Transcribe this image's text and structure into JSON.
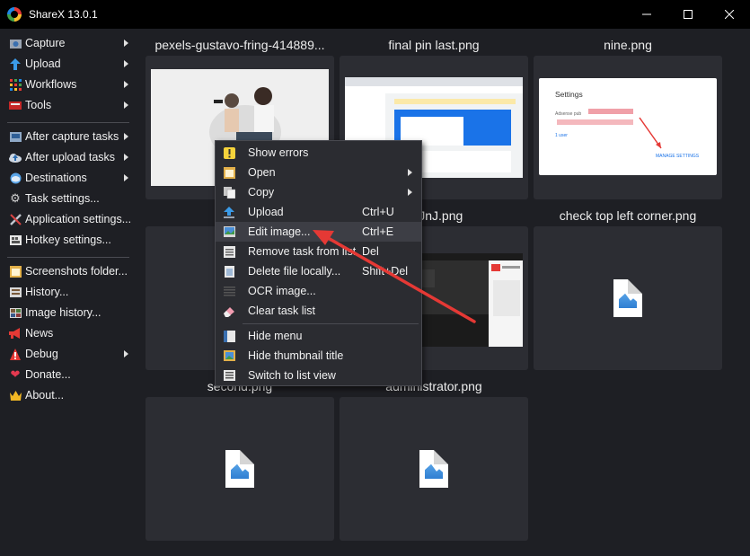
{
  "window": {
    "title": "ShareX 13.0.1",
    "minimize": "—",
    "maximize": "☐",
    "close": "✕"
  },
  "sidebar": {
    "items": [
      {
        "label": "Capture",
        "icon": "capture-icon"
      },
      {
        "label": "Upload",
        "icon": "upload-icon"
      },
      {
        "label": "Workflows",
        "icon": "workflows-icon"
      },
      {
        "label": "Tools",
        "icon": "tools-icon"
      },
      {
        "label": "After capture tasks",
        "icon": "after-capture-icon"
      },
      {
        "label": "After upload tasks",
        "icon": "after-upload-icon"
      },
      {
        "label": "Destinations",
        "icon": "destinations-icon"
      },
      {
        "label": "Task settings...",
        "icon": "gear-icon"
      },
      {
        "label": "Application settings...",
        "icon": "wrench-icon"
      },
      {
        "label": "Hotkey settings...",
        "icon": "keyboard-icon"
      },
      {
        "label": "Screenshots folder...",
        "icon": "folder-icon"
      },
      {
        "label": "History...",
        "icon": "history-icon"
      },
      {
        "label": "Image history...",
        "icon": "image-history-icon"
      },
      {
        "label": "News",
        "icon": "megaphone-icon"
      },
      {
        "label": "Debug",
        "icon": "debug-icon"
      },
      {
        "label": "Donate...",
        "icon": "heart-icon"
      },
      {
        "label": "About...",
        "icon": "crown-icon"
      }
    ]
  },
  "tiles": [
    {
      "title": "pexels-gustavo-fring-414889..."
    },
    {
      "title": "final pin last.png"
    },
    {
      "title": "nine.png"
    },
    {
      "title": "LnJnJ.png"
    },
    {
      "title": "check top left corner.png"
    },
    {
      "title": "second.png"
    },
    {
      "title": "administrator.png"
    }
  ],
  "thumbs": {
    "settings_title": "Settings",
    "adsense_text": "Adsense pub",
    "user_text": "1 user",
    "manage_settings": "MANAGE SETTINGS"
  },
  "context_menu": {
    "items": [
      {
        "label": "Show errors",
        "shortcut": "",
        "icon": "warning-icon"
      },
      {
        "label": "Open",
        "shortcut": "",
        "icon": "open-icon"
      },
      {
        "label": "Copy",
        "shortcut": "",
        "icon": "copy-icon"
      },
      {
        "label": "Upload",
        "shortcut": "Ctrl+U",
        "icon": "upload-icon"
      },
      {
        "label": "Edit image...",
        "shortcut": "Ctrl+E",
        "icon": "edit-image-icon"
      },
      {
        "label": "Remove task from list",
        "shortcut": "Del",
        "icon": "remove-icon"
      },
      {
        "label": "Delete file locally...",
        "shortcut": "Shift+Del",
        "icon": "delete-file-icon"
      },
      {
        "label": "OCR image...",
        "shortcut": "",
        "icon": "ocr-icon"
      },
      {
        "label": "Clear task list",
        "shortcut": "",
        "icon": "eraser-icon"
      },
      {
        "label": "Hide menu",
        "shortcut": "",
        "icon": "hide-menu-icon"
      },
      {
        "label": "Hide thumbnail title",
        "shortcut": "",
        "icon": "thumbnail-icon"
      },
      {
        "label": "Switch to list view",
        "shortcut": "",
        "icon": "list-view-icon"
      }
    ]
  },
  "colors": {
    "background": "#1e1f24",
    "tile": "#2c2d33",
    "arrow": "#e53935"
  }
}
